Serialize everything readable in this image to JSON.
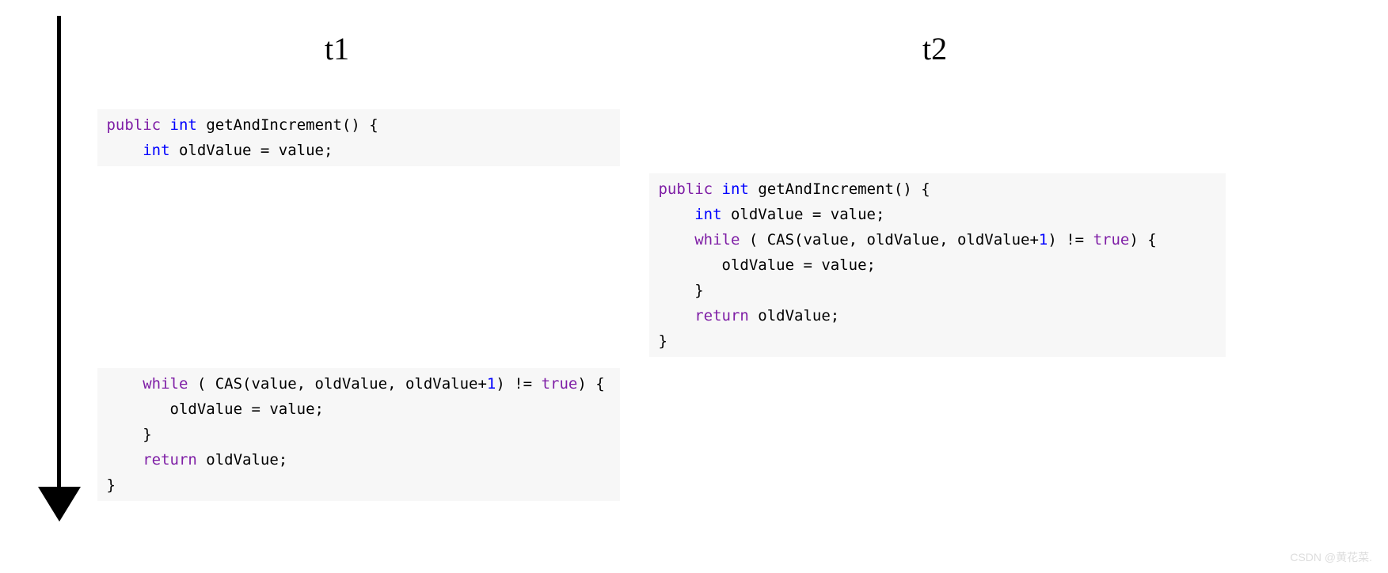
{
  "headers": {
    "t1": "t1",
    "t2": "t2"
  },
  "code": {
    "kw_public": "public",
    "kw_int": "int",
    "kw_while": "while",
    "kw_return": "return",
    "kw_true": "true",
    "fn_name": " getAndIncrement() {",
    "decl_old": " oldValue = value;",
    "while_open": " ( CAS(value, oldValue, oldValue+",
    "one": "1",
    "while_close": ") != ",
    "while_end": ") {",
    "assign": "oldValue = value;",
    "brace": "}",
    "ret": " oldValue;"
  },
  "watermark": "CSDN @黄花菜."
}
